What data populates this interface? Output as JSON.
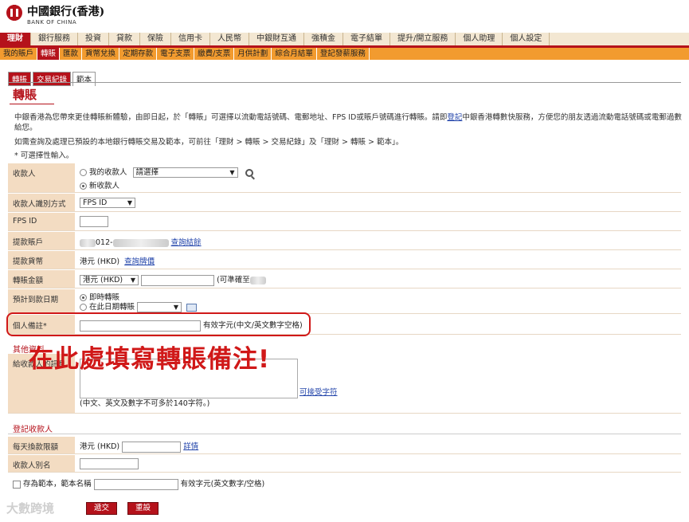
{
  "brand": {
    "name_zh": "中國銀行(香港)",
    "name_en": "BANK OF CHINA"
  },
  "nav_main": [
    "理財",
    "銀行服務",
    "投資",
    "貸款",
    "保險",
    "信用卡",
    "人民幣",
    "中銀財互通",
    "強積金",
    "電子結單",
    "提升/開立服務",
    "個人助理",
    "個人設定"
  ],
  "nav_sub": [
    "我的賬戶",
    "轉賬",
    "匯款",
    "貨幣兌換",
    "定期存款",
    "電子支票",
    "繳費/支票",
    "月供計劃",
    "綜合月結單",
    "登記發薪服務"
  ],
  "tabs": [
    "轉賬",
    "交易紀錄",
    "範本"
  ],
  "page_title": "轉賬",
  "intro_text_a": "中銀香港為您帶來更佳轉賬新體驗，由即日起，於「轉賬」可選擇以流動電話號碼、電郵地址、FPS ID或賬戶號碼進行轉賬。請即",
  "intro_link": "登記",
  "intro_text_b": "中銀香港轉數快服務，方便您的朋友透過流動電話號碼或電郵過數給您。",
  "intro2": "如需查詢及處理已預設的本地銀行轉賬交易及範本，可前往「理財 > 轉賬 > 交易紀錄」及「理財 > 轉賬 > 範本」。",
  "optional_note": "* 可選擇性輸入。",
  "form": {
    "payee_label": "收款人",
    "my_payee": "我的收款人",
    "payee_select": "請選擇",
    "new_payee": "新收款人",
    "id_method_label": "收款人識別方式",
    "id_method_value": "FPS ID",
    "fps_label": "FPS ID",
    "from_label": "提款賬戶",
    "from_value": "012-",
    "balance_link": "查詢結餘",
    "currency_label": "提款貨幣",
    "currency_value": "港元 (HKD)",
    "rate_link": "查詢牌價",
    "amount_label": "轉賬金額",
    "amount_currency": "港元 (HKD)",
    "amount_note": "(可準確至",
    "date_label": "預計到款日期",
    "immediate": "即時轉賬",
    "on_date": "在此日期轉賬",
    "remark_label": "個人備註*",
    "remark_hint": "有效字元(中文/英文數字空格)",
    "other_section": "其他資料",
    "msg_label": "給收款人的訊息",
    "special_chars_link": "可接受字符",
    "msg_hint": "(中文、英文及數字不可多於140字符。)",
    "register_section": "登記收款人",
    "daily_limit_label": "每天換款限額",
    "daily_limit_currency": "港元 (HKD)",
    "details_link": "詳情",
    "alias_label": "收款人別名",
    "save_template": "存為範本，範本名稱",
    "template_hint": "有效字元(英文數字/空格)"
  },
  "annotation": "在此處填寫轉賬備注!",
  "buttons": {
    "submit": "遞交",
    "reset": "重設"
  },
  "watermark": "大數跨境",
  "colors": {
    "brand_red": "#b5121b",
    "orange": "#f29b2f",
    "label_bg": "#f3dcc2",
    "annotation_red": "#d01818"
  }
}
